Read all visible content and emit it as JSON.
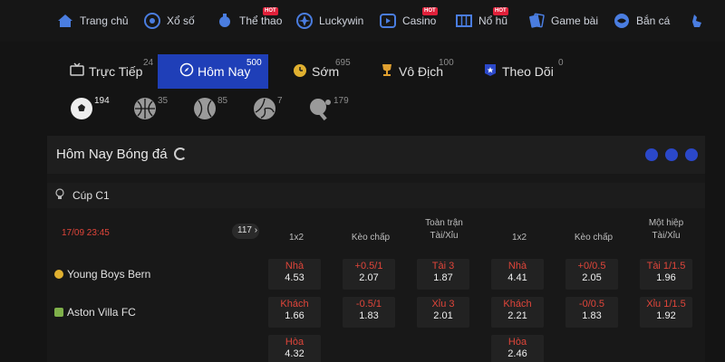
{
  "nav": {
    "items": [
      {
        "label": "Trang chủ",
        "icon": "home-icon"
      },
      {
        "label": "Xổ số",
        "icon": "lottery-icon"
      },
      {
        "label": "Thể thao",
        "icon": "sports-icon",
        "badge": "HOT"
      },
      {
        "label": "Luckywin",
        "icon": "luckywin-icon"
      },
      {
        "label": "Casino",
        "icon": "casino-icon",
        "badge": "HOT"
      },
      {
        "label": "Nổ hũ",
        "icon": "slot-icon",
        "badge": "HOT"
      },
      {
        "label": "Game bài",
        "icon": "cards-icon"
      },
      {
        "label": "Bắn cá",
        "icon": "fish-icon"
      }
    ],
    "accent": "#4a7de0",
    "badge_color": "#e0203a"
  },
  "tabs": [
    {
      "label": "Trực Tiếp",
      "count": "24"
    },
    {
      "label": "Hôm Nay",
      "count": "500"
    },
    {
      "label": "Sớm",
      "count": "695"
    },
    {
      "label": "Vô Địch",
      "count": "100"
    },
    {
      "label": "Theo Dõi",
      "count": "0"
    }
  ],
  "active_tab_color": "#1f3fb8",
  "sports": [
    {
      "icon": "soccer-ball-icon",
      "count": "194"
    },
    {
      "icon": "basketball-icon",
      "count": "35"
    },
    {
      "icon": "tennis-ball-icon",
      "count": "85"
    },
    {
      "icon": "volleyball-icon",
      "count": "7"
    },
    {
      "icon": "table-tennis-icon",
      "count": "179"
    }
  ],
  "panel": {
    "title": "Hôm Nay Bóng đá"
  },
  "league": {
    "name": "Cúp C1"
  },
  "match": {
    "datetime": "17/09 23:45",
    "more_count": "117 ›",
    "home": "Young Boys Bern",
    "away": "Aston Villa FC"
  },
  "columns": [
    {
      "label": "1x2"
    },
    {
      "label": "Kèo chấp"
    },
    {
      "label": "Toàn trận\nTài/Xỉu"
    },
    {
      "label": "1x2"
    },
    {
      "label": "Kèo chấp"
    },
    {
      "label": "Một hiệp\nTài/Xỉu"
    }
  ],
  "odds": {
    "ft_1x2": [
      {
        "lbl": "Nhà",
        "val": "4.53"
      },
      {
        "lbl": "Khách",
        "val": "1.66"
      },
      {
        "lbl": "Hòa",
        "val": "4.32"
      }
    ],
    "ft_hdp": [
      {
        "lbl": "+0.5/1",
        "val": "2.07"
      },
      {
        "lbl": "-0.5/1",
        "val": "1.83"
      }
    ],
    "ft_ou": [
      {
        "lbl": "Tài 3",
        "val": "1.87"
      },
      {
        "lbl": "Xỉu 3",
        "val": "2.01"
      }
    ],
    "h1_1x2": [
      {
        "lbl": "Nhà",
        "val": "4.41"
      },
      {
        "lbl": "Khách",
        "val": "2.21"
      },
      {
        "lbl": "Hòa",
        "val": "2.46"
      }
    ],
    "h1_hdp": [
      {
        "lbl": "+0/0.5",
        "val": "2.05"
      },
      {
        "lbl": "-0/0.5",
        "val": "1.83"
      }
    ],
    "h1_ou": [
      {
        "lbl": "Tài 1/1.5",
        "val": "1.96"
      },
      {
        "lbl": "Xỉu 1/1.5",
        "val": "1.92"
      }
    ]
  }
}
